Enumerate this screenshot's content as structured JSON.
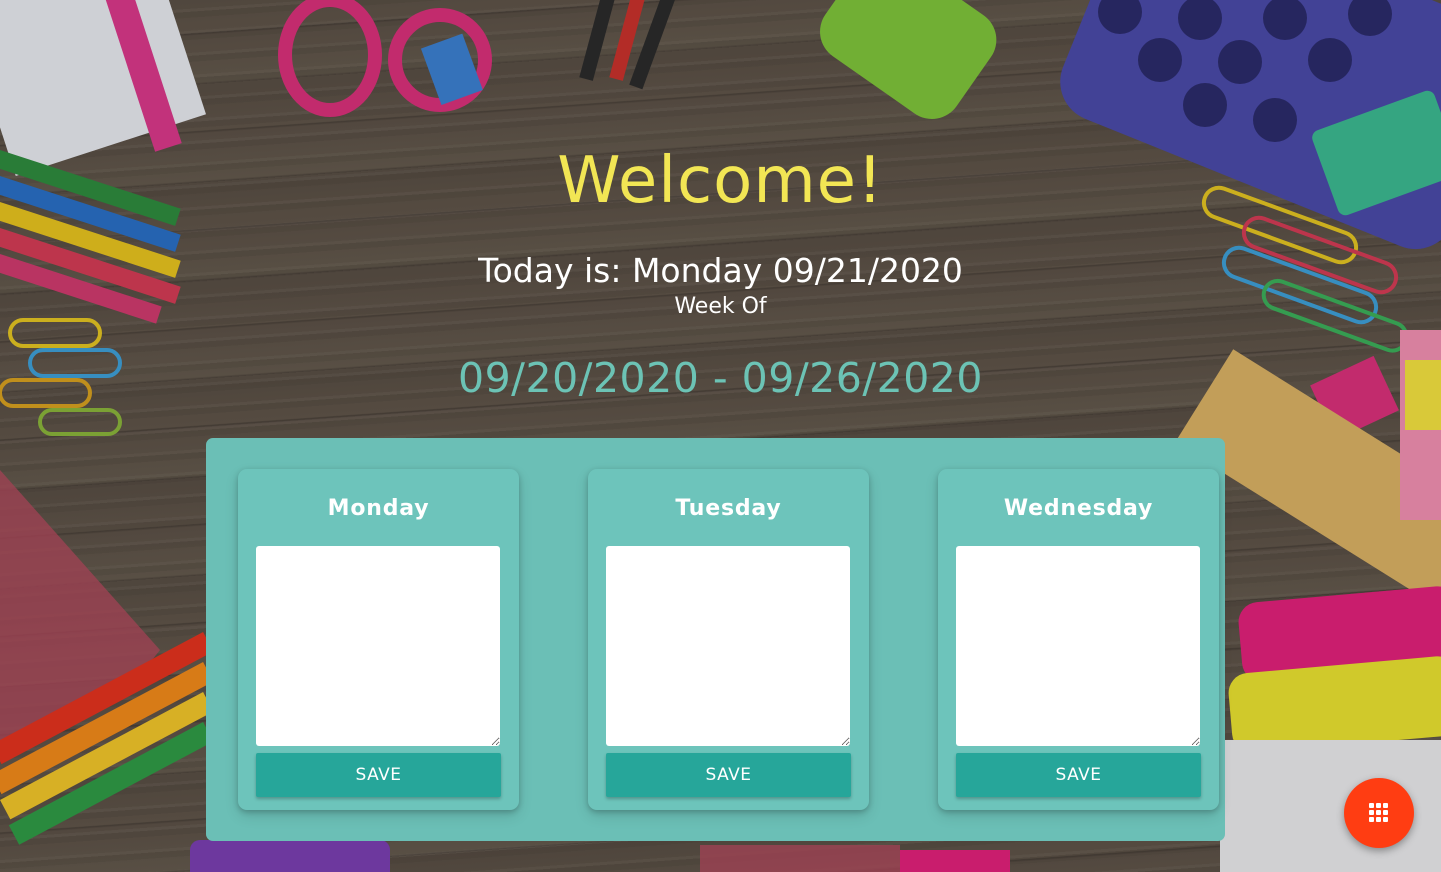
{
  "header": {
    "welcome": "Welcome!",
    "today_text": "Today is: Monday 09/21/2020",
    "week_of_label": "Week Of",
    "week_range": "09/20/2020 - 09/26/2020"
  },
  "days": [
    {
      "name": "Monday",
      "notes": "",
      "save_label": "SAVE"
    },
    {
      "name": "Tuesday",
      "notes": "",
      "save_label": "SAVE"
    },
    {
      "name": "Wednesday",
      "notes": "",
      "save_label": "SAVE"
    }
  ],
  "fab": {
    "icon": "apps-grid-icon"
  },
  "colors": {
    "welcome": "#f2e654",
    "range": "#6cc3b5",
    "panel": "#6bbfb6",
    "save_button": "#26a69a",
    "fab": "#ff3d12"
  }
}
